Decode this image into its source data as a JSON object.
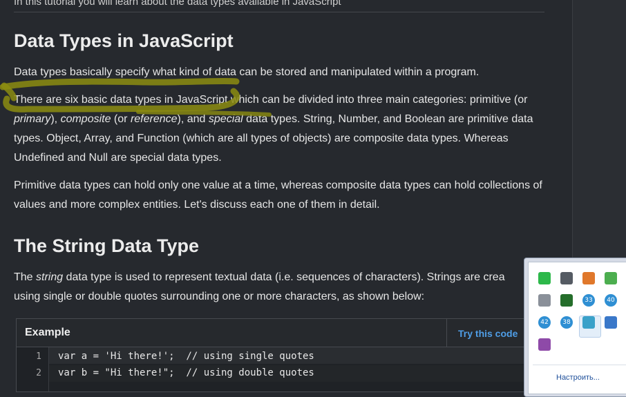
{
  "intro_line": "In this tutorial you will learn about the data types available in JavaScript",
  "section1": {
    "heading": "Data Types in JavaScript",
    "para1": "Data types basically specify what kind of data can be stored and manipulated within a program.",
    "para2": {
      "t1": "There are six basic data types in JavaScript which can be divided into three main categories: primitive (or ",
      "i1": "primary",
      "t2": "), ",
      "i2": "composite",
      "t3": " (or ",
      "i3": "reference",
      "t4": "), and ",
      "i4": "special",
      "t5": " data types. String, Number, and Boolean are primitive data types. Object, Array, and Function (which are all types of objects) are composite data types. Whereas Undefined and Null are special data types."
    },
    "para3": "Primitive data types can hold only one value at a time, whereas composite data types can hold collections of values and more complex entities. Let's discuss each one of them in detail."
  },
  "section2": {
    "heading": "The String Data Type",
    "para": {
      "t1": "The ",
      "i1": "string",
      "t2": " data type is used to represent textual data (i.e. sequences of characters). Strings are crea",
      "t3": "using single or double quotes surrounding one or more characters, as shown below:"
    }
  },
  "example": {
    "title": "Example",
    "try_label": "Try this code",
    "lines": [
      {
        "num": "1",
        "code": "var a = 'Hi there!';  // using single quotes"
      },
      {
        "num": "2",
        "code": "var b = \"Hi there!\";  // using double quotes"
      }
    ]
  },
  "tray": {
    "customize_label": "Настроить...",
    "icons": [
      {
        "name": "green-app-icon",
        "color": "#2db84a",
        "label": ""
      },
      {
        "name": "monitor-icon",
        "color": "#555b63",
        "label": ""
      },
      {
        "name": "orange-blue-app-icon",
        "color": "#e0782b",
        "label": ""
      },
      {
        "name": "network-check-icon",
        "color": "#4cae4f",
        "label": ""
      },
      {
        "name": "drive-icon",
        "color": "#8a9099",
        "label": ""
      },
      {
        "name": "chip-icon",
        "color": "#256e2b",
        "label": ""
      },
      {
        "name": "cpu-temp-33-icon",
        "color": "#2f8fd3",
        "label": "33"
      },
      {
        "name": "cpu-temp-40-icon",
        "color": "#2f8fd3",
        "label": "40"
      },
      {
        "name": "gpu-temp-42-icon",
        "color": "#2f8fd3",
        "label": "42"
      },
      {
        "name": "gpu-temp-38-icon",
        "color": "#2f8fd3",
        "label": "38"
      },
      {
        "name": "pen-tablet-icon",
        "color": "#3aa1c9",
        "label": ""
      },
      {
        "name": "bluetooth-globe-icon",
        "color": "#3a78c9",
        "label": ""
      },
      {
        "name": "notes-app-icon",
        "color": "#8e4aa8",
        "label": ""
      }
    ]
  },
  "colors": {
    "background": "#26292e",
    "highlight": "#8c8c10",
    "link": "#4f9ee7"
  }
}
